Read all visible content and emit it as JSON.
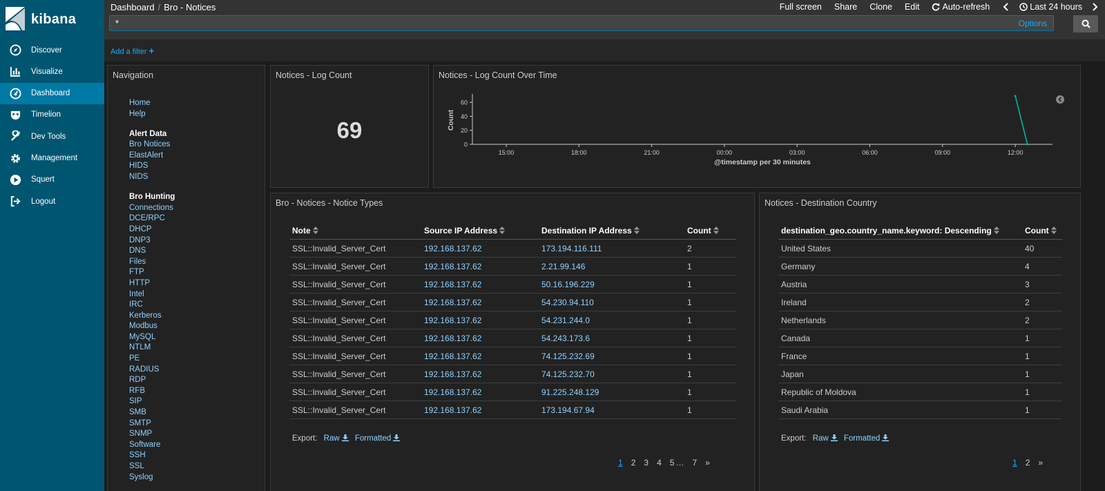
{
  "app": {
    "name": "kibana"
  },
  "sidebar": {
    "items": [
      {
        "label": "Discover",
        "icon": "compass-icon"
      },
      {
        "label": "Visualize",
        "icon": "bar-chart-icon"
      },
      {
        "label": "Dashboard",
        "icon": "dashboard-gauge-icon",
        "active": true
      },
      {
        "label": "Timelion",
        "icon": "timelion-mask-icon"
      },
      {
        "label": "Dev Tools",
        "icon": "wrench-icon"
      },
      {
        "label": "Management",
        "icon": "gear-icon"
      },
      {
        "label": "Squert",
        "icon": "play-circle-icon"
      },
      {
        "label": "Logout",
        "icon": "logout-icon"
      }
    ]
  },
  "header": {
    "breadcrumb": [
      "Dashboard",
      "Bro - Notices"
    ],
    "actions": {
      "full_screen": "Full screen",
      "share": "Share",
      "clone": "Clone",
      "edit": "Edit",
      "auto_refresh": "Auto-refresh",
      "time_range": "Last 24 hours"
    },
    "search": {
      "value": "*",
      "options": "Options"
    },
    "add_filter": "Add a filter"
  },
  "navigation_panel": {
    "title": "Navigation",
    "top_links": [
      "Home",
      "Help"
    ],
    "alert_group": {
      "heading": "Alert Data",
      "links": [
        "Bro Notices",
        "ElastAlert",
        "HIDS",
        "NIDS"
      ]
    },
    "hunting_group": {
      "heading": "Bro Hunting",
      "links": [
        "Connections",
        "DCE/RPC",
        "DHCP",
        "DNP3",
        "DNS",
        "Files",
        "FTP",
        "HTTP",
        "Intel",
        "IRC",
        "Kerberos",
        "Modbus",
        "MySQL",
        "NTLM",
        "PE",
        "RADIUS",
        "RDP",
        "RFB",
        "SIP",
        "SMB",
        "SMTP",
        "SNMP",
        "Software",
        "SSH",
        "SSL",
        "Syslog"
      ]
    }
  },
  "log_count_panel": {
    "title": "Notices - Log Count",
    "value": "69"
  },
  "chart_panel": {
    "title": "Notices - Log Count Over Time"
  },
  "chart_data": {
    "type": "line",
    "title": "Notices - Log Count Over Time",
    "xlabel": "@timestamp per 30 minutes",
    "ylabel": "Count",
    "x_ticks": [
      "15:00",
      "18:00",
      "21:00",
      "00:00",
      "03:00",
      "06:00",
      "09:00",
      "12:00"
    ],
    "y_ticks": [
      0,
      20,
      40,
      60
    ],
    "ylim": [
      0,
      69
    ],
    "series": [
      {
        "x": [
          "12:00",
          "12:30"
        ],
        "y": [
          69,
          0
        ],
        "color": "#00b3a4"
      }
    ]
  },
  "notice_types_panel": {
    "title": "Bro - Notices - Notice Types",
    "columns": [
      "Note",
      "Source IP Address",
      "Destination IP Address",
      "Count"
    ],
    "rows": [
      [
        "SSL::Invalid_Server_Cert",
        "192.168.137.62",
        "173.194.116.111",
        "2"
      ],
      [
        "SSL::Invalid_Server_Cert",
        "192.168.137.62",
        "2.21.99.146",
        "1"
      ],
      [
        "SSL::Invalid_Server_Cert",
        "192.168.137.62",
        "50.16.196.229",
        "1"
      ],
      [
        "SSL::Invalid_Server_Cert",
        "192.168.137.62",
        "54.230.94.110",
        "1"
      ],
      [
        "SSL::Invalid_Server_Cert",
        "192.168.137.62",
        "54.231.244.0",
        "1"
      ],
      [
        "SSL::Invalid_Server_Cert",
        "192.168.137.62",
        "54.243.173.6",
        "1"
      ],
      [
        "SSL::Invalid_Server_Cert",
        "192.168.137.62",
        "74.125.232.69",
        "1"
      ],
      [
        "SSL::Invalid_Server_Cert",
        "192.168.137.62",
        "74.125.232.70",
        "1"
      ],
      [
        "SSL::Invalid_Server_Cert",
        "192.168.137.62",
        "91.225.248.129",
        "1"
      ],
      [
        "SSL::Invalid_Server_Cert",
        "192.168.137.62",
        "173.194.67.94",
        "1"
      ]
    ],
    "export": {
      "label": "Export:",
      "raw": "Raw",
      "formatted": "Formatted"
    },
    "pager": [
      "1",
      "2",
      "3",
      "4",
      "5",
      "…",
      "7",
      "»"
    ]
  },
  "country_panel": {
    "title": "Notices - Destination Country",
    "columns": [
      "destination_geo.country_name.keyword: Descending",
      "Count"
    ],
    "rows": [
      [
        "United States",
        "40"
      ],
      [
        "Germany",
        "4"
      ],
      [
        "Austria",
        "3"
      ],
      [
        "Ireland",
        "2"
      ],
      [
        "Netherlands",
        "2"
      ],
      [
        "Canada",
        "1"
      ],
      [
        "France",
        "1"
      ],
      [
        "Japan",
        "1"
      ],
      [
        "Republic of Moldova",
        "1"
      ],
      [
        "Saudi Arabia",
        "1"
      ]
    ],
    "export": {
      "label": "Export:",
      "raw": "Raw",
      "formatted": "Formatted"
    },
    "pager": [
      "1",
      "2",
      "»"
    ]
  },
  "colors": {
    "sidebar": "#005571",
    "active": "#0079a5",
    "link": "#8fd2ff",
    "accent": "#1ba9f5",
    "series": "#00b3a4"
  }
}
